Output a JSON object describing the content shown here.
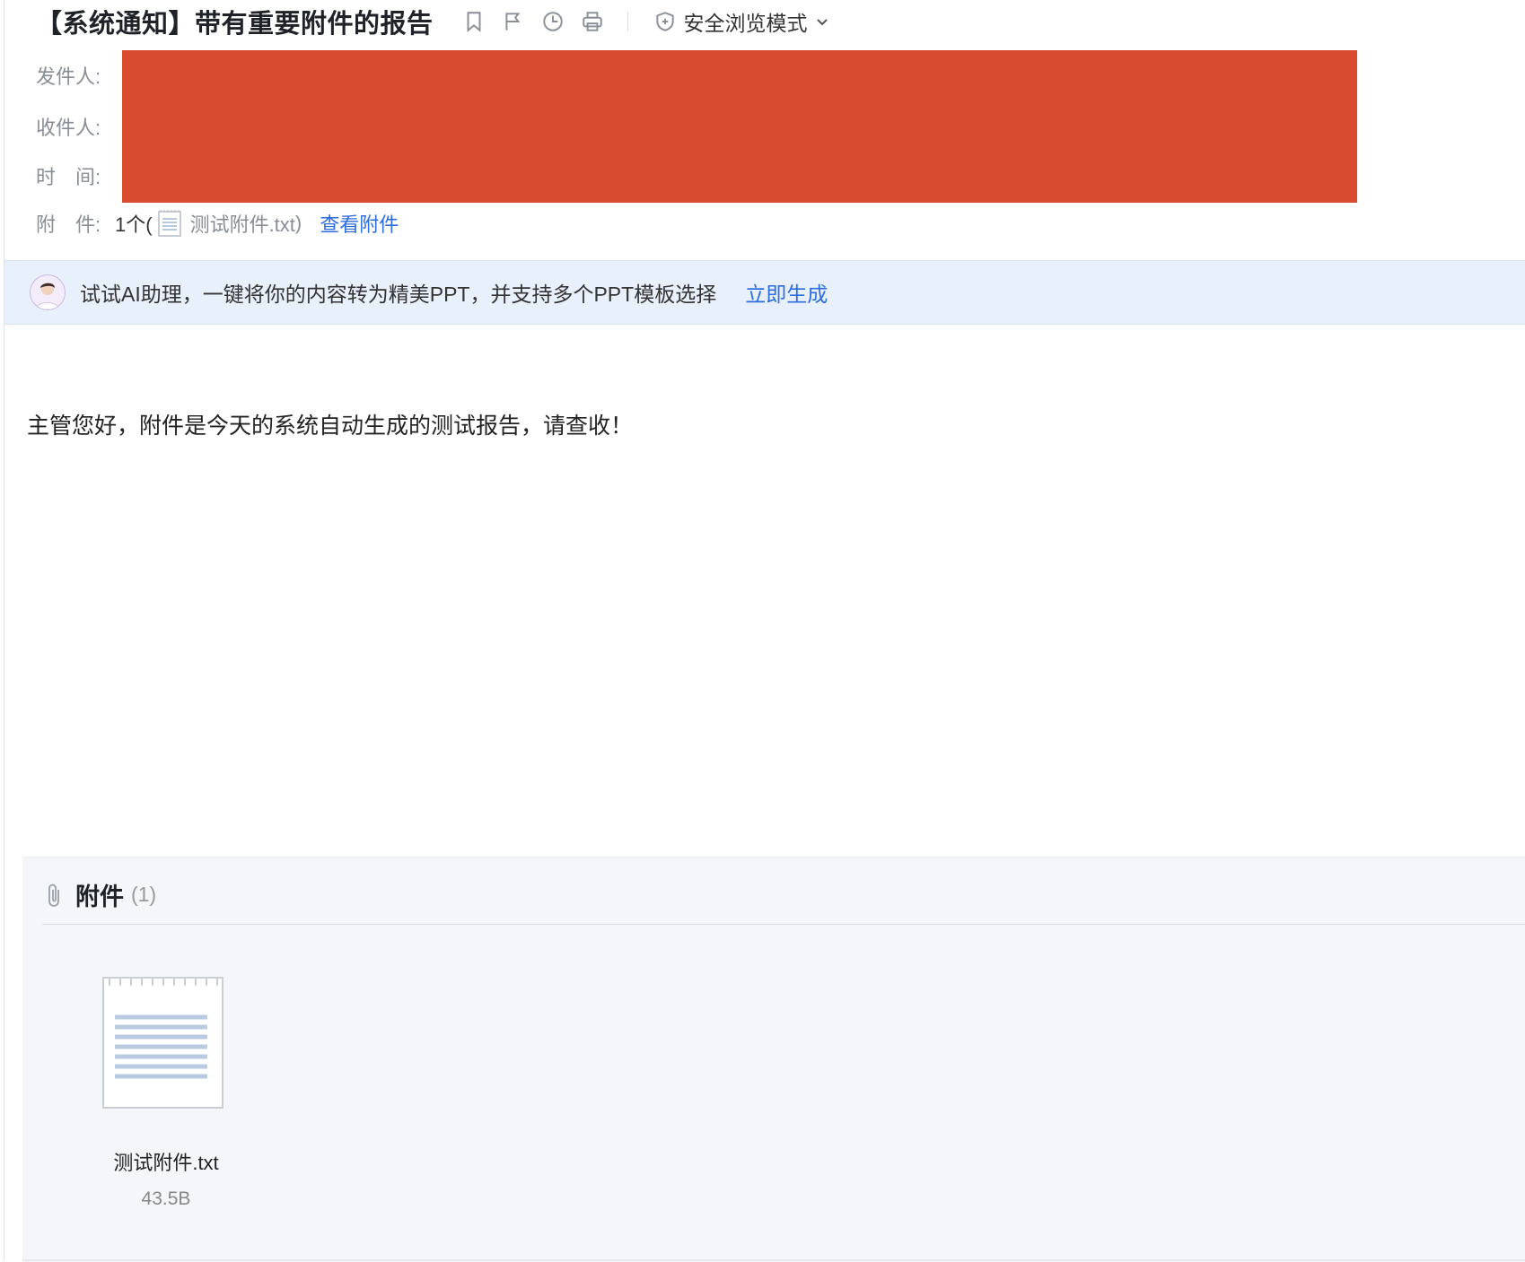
{
  "mail": {
    "subject": "【系统通知】带有重要附件的报告",
    "toolbar": {
      "icons": [
        "bookmark-icon",
        "flag-icon",
        "clock-icon",
        "print-icon"
      ],
      "safe_mode_label": "安全浏览模式"
    },
    "meta": {
      "sender_label": "发件人:",
      "recipient_label": "收件人:",
      "time_label": "时　间:",
      "attachment_label": "附　件:",
      "attachment_count_prefix": "1个(",
      "attachment_inline_name": "测试附件.txt",
      "attachment_inline_suffix": " )",
      "view_attachment_link": "查看附件",
      "redaction_color": "#d84b30"
    },
    "ai_banner": {
      "text": "试试AI助理，一键将你的内容转为精美PPT，并支持多个PPT模板选择",
      "action": "立即生成"
    },
    "body_text": "主管您好，附件是今天的系统自动生成的测试报告，请查收！",
    "attachments_panel": {
      "title": "附件",
      "count": "(1)",
      "files": [
        {
          "name": "测试附件.txt",
          "size": "43.5B",
          "icon": "text-file-icon"
        }
      ]
    }
  },
  "colors": {
    "link": "#2d6cdf",
    "banner_bg": "#e8f0fc",
    "panel_bg": "#f5f6f9"
  }
}
